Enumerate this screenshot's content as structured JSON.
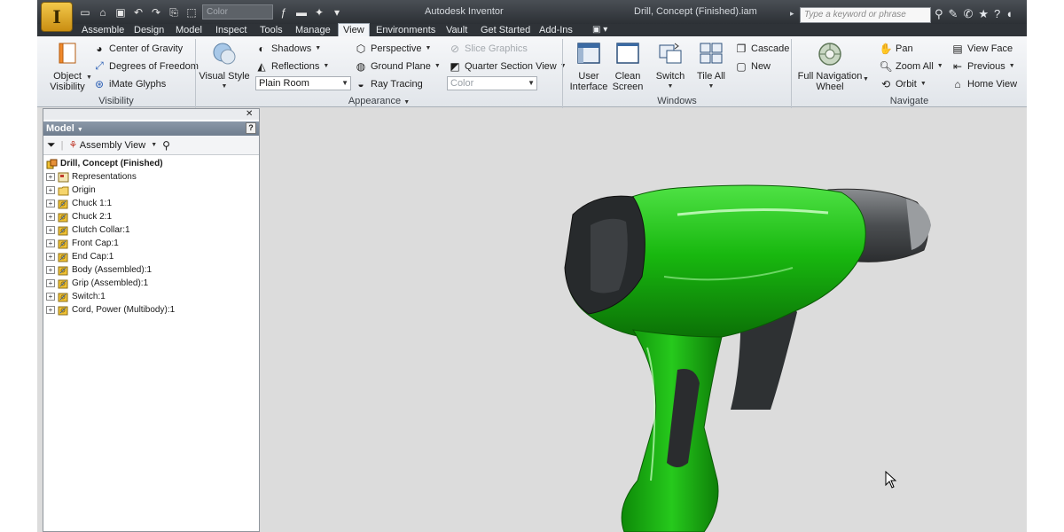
{
  "title_bar": {
    "app_title": "Autodesk Inventor",
    "document_title": "Drill, Concept (Finished).iam",
    "color_combo": "Color",
    "search_placeholder": "Type a keyword or phrase"
  },
  "tabs": [
    {
      "label": "Assemble"
    },
    {
      "label": "Design"
    },
    {
      "label": "Model"
    },
    {
      "label": "Inspect"
    },
    {
      "label": "Tools"
    },
    {
      "label": "Manage"
    },
    {
      "label": "View",
      "active": true
    },
    {
      "label": "Environments"
    },
    {
      "label": "Vault"
    },
    {
      "label": "Get Started"
    },
    {
      "label": "Add-Ins"
    }
  ],
  "ribbon": {
    "visibility": {
      "object_visibility": "Object\nVisibility",
      "center_of_gravity": "Center of Gravity",
      "degrees_of_freedom": "Degrees of Freedom",
      "imate_glyphs": "iMate Glyphs",
      "label": "Visibility"
    },
    "appearance": {
      "visual_style": "Visual Style",
      "shadows": "Shadows",
      "reflections": "Reflections",
      "lighting_combo": "Plain Room",
      "perspective": "Perspective",
      "ground_plane": "Ground Plane",
      "ray_tracing": "Ray Tracing",
      "slice_graphics": "Slice Graphics",
      "quarter_section_view": "Quarter Section View",
      "color_combo": "Color",
      "label": "Appearance"
    },
    "windows": {
      "user_interface": "User\nInterface",
      "clean_screen": "Clean\nScreen",
      "switch": "Switch",
      "tile_all": "Tile All",
      "cascade": "Cascade",
      "new": "New",
      "label": "Windows"
    },
    "navigate": {
      "full_navigation_wheel": "Full Navigation\nWheel",
      "pan": "Pan",
      "zoom_all": "Zoom All",
      "orbit": "Orbit",
      "view_face": "View Face",
      "previous": "Previous",
      "home_view": "Home View",
      "label": "Navigate"
    }
  },
  "browser": {
    "header": "Model",
    "view_combo": "Assembly View",
    "root": "Drill, Concept (Finished)",
    "items": [
      {
        "label": "Representations",
        "icon": "representations-icon"
      },
      {
        "label": "Origin",
        "icon": "folder-icon"
      },
      {
        "label": "Chuck 1:1",
        "icon": "part-icon"
      },
      {
        "label": "Chuck 2:1",
        "icon": "part-icon"
      },
      {
        "label": "Clutch Collar:1",
        "icon": "part-icon"
      },
      {
        "label": "Front Cap:1",
        "icon": "part-icon"
      },
      {
        "label": "End Cap:1",
        "icon": "part-icon"
      },
      {
        "label": "Body (Assembled):1",
        "icon": "part-icon"
      },
      {
        "label": "Grip (Assembled):1",
        "icon": "part-icon"
      },
      {
        "label": "Switch:1",
        "icon": "part-icon"
      },
      {
        "label": "Cord, Power (Multibody):1",
        "icon": "part-icon"
      }
    ]
  },
  "colors": {
    "drill_body": "#16b80f",
    "drill_dark": "#2d2f31",
    "viewport_bg": "#dcdcdc",
    "app_button": "#e6a91e"
  }
}
